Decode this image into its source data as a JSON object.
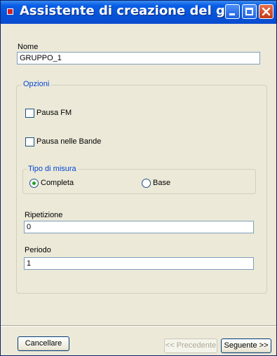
{
  "window": {
    "title": "Assistente di creazione del g..."
  },
  "form": {
    "name_label": "Nome",
    "name_value": "GRUPPO_1",
    "options_legend": "Opzioni",
    "pause_fm_label": "Pausa FM",
    "pause_fm_checked": false,
    "pause_bands_label": "Pausa nelle Bande",
    "pause_bands_checked": false,
    "measure_legend": "Tipo di misura",
    "measure_options": [
      {
        "label": "Completa",
        "selected": true
      },
      {
        "label": "Base",
        "selected": false
      }
    ],
    "repetition_label": "Ripetizione",
    "repetition_value": "0",
    "period_label": "Periodo",
    "period_value": "1"
  },
  "buttons": {
    "cancel": "Cancellare",
    "previous": "<< Precedente",
    "next": "Seguente >>"
  },
  "colors": {
    "title_bar": "#0553d8",
    "legend_text": "#0046d5",
    "radio_dot": "#21a121"
  }
}
